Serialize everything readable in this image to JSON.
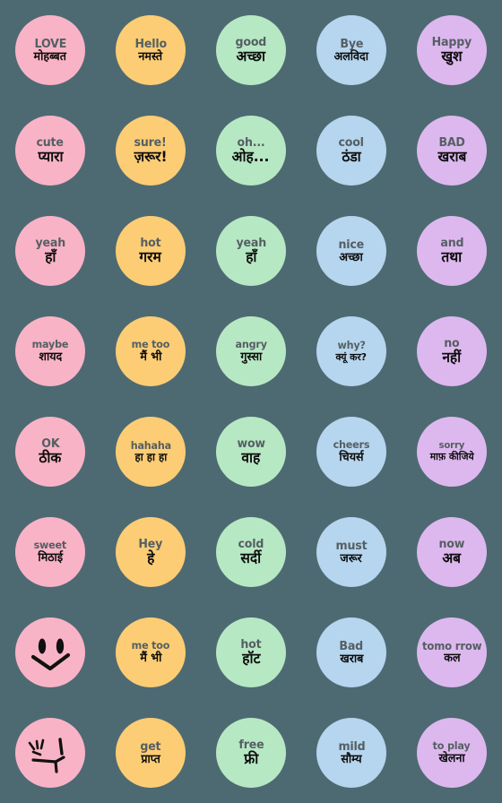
{
  "page": {
    "title": "Hindi Emoji Sticker Pack",
    "background_color": "#4d6a72",
    "columns": 5,
    "rows": 8
  },
  "palette": {
    "pink": "#f9b3c7",
    "orange": "#fccd74",
    "green": "#b7e8c4",
    "blue": "#b6d5ee",
    "purple": "#ddb8ee",
    "english_text": "#555f63",
    "hindi_text": "#0d0d0d",
    "face_stroke": "#111111"
  },
  "stickers": [
    {
      "id": "love",
      "row": 1,
      "col": 1,
      "color_key": "pink",
      "color": "#f9b3c7",
      "en": "LOVE",
      "hi": "मोहब्बत"
    },
    {
      "id": "hello",
      "row": 1,
      "col": 2,
      "color_key": "orange",
      "color": "#fccd74",
      "en": "Hello",
      "hi": "नमस्ते"
    },
    {
      "id": "good",
      "row": 1,
      "col": 3,
      "color_key": "green",
      "color": "#b7e8c4",
      "en": "good",
      "hi": "अच्छा"
    },
    {
      "id": "bye",
      "row": 1,
      "col": 4,
      "color_key": "blue",
      "color": "#b6d5ee",
      "en": "Bye",
      "hi": "अलविदा"
    },
    {
      "id": "happy",
      "row": 1,
      "col": 5,
      "color_key": "purple",
      "color": "#ddb8ee",
      "en": "Happy",
      "hi": "खुश"
    },
    {
      "id": "cute",
      "row": 2,
      "col": 1,
      "color_key": "pink",
      "color": "#f9b3c7",
      "en": "cute",
      "hi": "प्यारा"
    },
    {
      "id": "sure",
      "row": 2,
      "col": 2,
      "color_key": "orange",
      "color": "#fccd74",
      "en": "sure!",
      "hi": "ज़रूर!"
    },
    {
      "id": "oh",
      "row": 2,
      "col": 3,
      "color_key": "green",
      "color": "#b7e8c4",
      "en": "oh...",
      "hi": "ओह..."
    },
    {
      "id": "cool",
      "row": 2,
      "col": 4,
      "color_key": "blue",
      "color": "#b6d5ee",
      "en": "cool",
      "hi": "ठंडा"
    },
    {
      "id": "bad",
      "row": 2,
      "col": 5,
      "color_key": "purple",
      "color": "#ddb8ee",
      "en": "BAD",
      "hi": "खराब"
    },
    {
      "id": "yeah-pink",
      "row": 3,
      "col": 1,
      "color_key": "pink",
      "color": "#f9b3c7",
      "en": "yeah",
      "hi": "हाँ"
    },
    {
      "id": "hot-warm",
      "row": 3,
      "col": 2,
      "color_key": "orange",
      "color": "#fccd74",
      "en": "hot",
      "hi": "गरम"
    },
    {
      "id": "yeah-grn",
      "row": 3,
      "col": 3,
      "color_key": "green",
      "color": "#b7e8c4",
      "en": "yeah",
      "hi": "हाँ"
    },
    {
      "id": "nice",
      "row": 3,
      "col": 4,
      "color_key": "blue",
      "color": "#b6d5ee",
      "en": "nice",
      "hi": "अच्छा"
    },
    {
      "id": "and",
      "row": 3,
      "col": 5,
      "color_key": "purple",
      "color": "#ddb8ee",
      "en": "and",
      "hi": "तथा"
    },
    {
      "id": "maybe",
      "row": 4,
      "col": 1,
      "color_key": "pink",
      "color": "#f9b3c7",
      "en": "maybe",
      "hi": "शायद"
    },
    {
      "id": "metoo-1",
      "row": 4,
      "col": 2,
      "color_key": "orange",
      "color": "#fccd74",
      "en": "me too",
      "hi": "मैं भी"
    },
    {
      "id": "angry",
      "row": 4,
      "col": 3,
      "color_key": "green",
      "color": "#b7e8c4",
      "en": "angry",
      "hi": "गुस्सा"
    },
    {
      "id": "why",
      "row": 4,
      "col": 4,
      "color_key": "blue",
      "color": "#b6d5ee",
      "en": "why?",
      "hi": "क्यूं कर?"
    },
    {
      "id": "no",
      "row": 4,
      "col": 5,
      "color_key": "purple",
      "color": "#ddb8ee",
      "en": "no",
      "hi": "नहीं"
    },
    {
      "id": "ok",
      "row": 5,
      "col": 1,
      "color_key": "pink",
      "color": "#f9b3c7",
      "en": "OK",
      "hi": "ठीक"
    },
    {
      "id": "hahaha",
      "row": 5,
      "col": 2,
      "color_key": "orange",
      "color": "#fccd74",
      "en": "hahaha",
      "hi": "हा हा हा"
    },
    {
      "id": "wow",
      "row": 5,
      "col": 3,
      "color_key": "green",
      "color": "#b7e8c4",
      "en": "wow",
      "hi": "वाह"
    },
    {
      "id": "cheers",
      "row": 5,
      "col": 4,
      "color_key": "blue",
      "color": "#b6d5ee",
      "en": "cheers",
      "hi": "चियर्स"
    },
    {
      "id": "sorry",
      "row": 5,
      "col": 5,
      "color_key": "purple",
      "color": "#ddb8ee",
      "en": "sorry",
      "hi": "माफ़ कीजिये"
    },
    {
      "id": "sweet",
      "row": 6,
      "col": 1,
      "color_key": "pink",
      "color": "#f9b3c7",
      "en": "sweet",
      "hi": "मिठाई"
    },
    {
      "id": "hey",
      "row": 6,
      "col": 2,
      "color_key": "orange",
      "color": "#fccd74",
      "en": "Hey",
      "hi": "हे"
    },
    {
      "id": "cold",
      "row": 6,
      "col": 3,
      "color_key": "green",
      "color": "#b7e8c4",
      "en": "cold",
      "hi": "सर्दी"
    },
    {
      "id": "must",
      "row": 6,
      "col": 4,
      "color_key": "blue",
      "color": "#b6d5ee",
      "en": "must",
      "hi": "जरूर"
    },
    {
      "id": "now",
      "row": 6,
      "col": 5,
      "color_key": "purple",
      "color": "#ddb8ee",
      "en": "now",
      "hi": "अब"
    },
    {
      "id": "smiley",
      "row": 7,
      "col": 1,
      "color_key": "pink",
      "color": "#f9b3c7",
      "en": "",
      "hi": "",
      "face": "smiley-face"
    },
    {
      "id": "metoo-2",
      "row": 7,
      "col": 2,
      "color_key": "orange",
      "color": "#fccd74",
      "en": "me too",
      "hi": "मैं भी"
    },
    {
      "id": "hot",
      "row": 7,
      "col": 3,
      "color_key": "green",
      "color": "#b7e8c4",
      "en": "hot",
      "hi": "हॉट"
    },
    {
      "id": "bad-2",
      "row": 7,
      "col": 4,
      "color_key": "blue",
      "color": "#b6d5ee",
      "en": "Bad",
      "hi": "खराब"
    },
    {
      "id": "tomorrow",
      "row": 7,
      "col": 5,
      "color_key": "purple",
      "color": "#ddb8ee",
      "en": "tomo rrow",
      "hi": "कल"
    },
    {
      "id": "dizzy",
      "row": 8,
      "col": 1,
      "color_key": "pink",
      "color": "#f9b3c7",
      "en": "",
      "hi": "",
      "face": "cropped-face"
    },
    {
      "id": "get",
      "row": 8,
      "col": 2,
      "color_key": "orange",
      "color": "#fccd74",
      "en": "get",
      "hi": "प्राप्त"
    },
    {
      "id": "free",
      "row": 8,
      "col": 3,
      "color_key": "green",
      "color": "#b7e8c4",
      "en": "free",
      "hi": "फ्री"
    },
    {
      "id": "mild",
      "row": 8,
      "col": 4,
      "color_key": "blue",
      "color": "#b6d5ee",
      "en": "mild",
      "hi": "सौम्य"
    },
    {
      "id": "toplay",
      "row": 8,
      "col": 5,
      "color_key": "purple",
      "color": "#ddb8ee",
      "en": "to play",
      "hi": "खेलना"
    }
  ]
}
